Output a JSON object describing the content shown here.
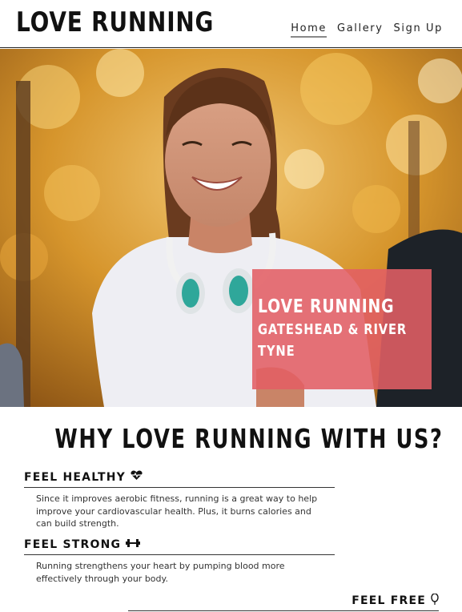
{
  "header": {
    "logo": "LOVE RUNNING",
    "nav": [
      {
        "label": "Home",
        "active": true
      },
      {
        "label": "Gallery",
        "active": false
      },
      {
        "label": "Sign Up",
        "active": false
      }
    ]
  },
  "hero": {
    "title": "LOVE RUNNING",
    "subtitle": "GATESHEAD & RIVER TYNE",
    "box_color": "#e25f64"
  },
  "why": {
    "title": "WHY LOVE RUNNING WITH US?",
    "features": [
      {
        "heading": "FEEL HEALTHY",
        "icon": "heartbeat-icon",
        "text": "Since it improves aerobic fitness, running is a great way to help improve your cardiovascular health. Plus, it burns calories and can build strength."
      },
      {
        "heading": "FEEL STRONG",
        "icon": "dumbbell-icon",
        "text": "Running strengthens your heart by pumping blood more effectively through your body."
      },
      {
        "heading": "FEEL FREE",
        "icon": "balloon-icon",
        "text": ""
      }
    ]
  }
}
